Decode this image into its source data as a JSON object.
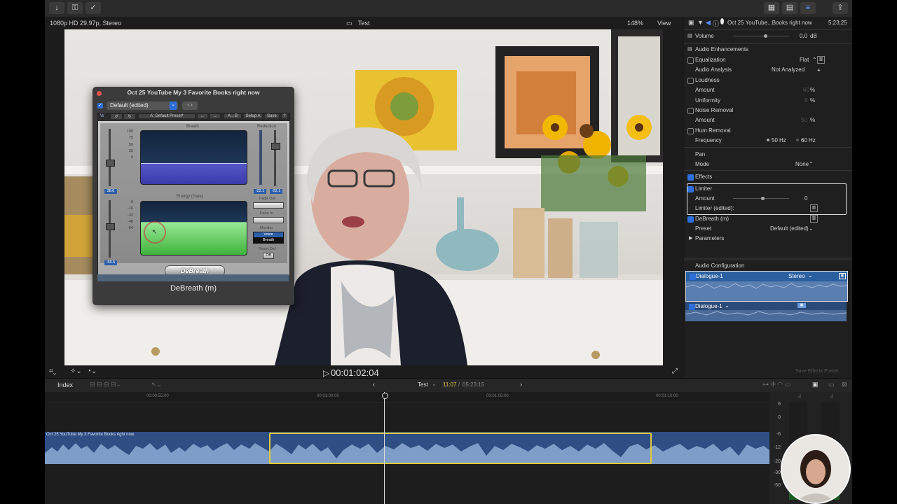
{
  "viewer": {
    "format": "1080p HD 29.97p, Stereo",
    "project_name": "Test",
    "zoom": "148%",
    "view_menu": "View",
    "timecode": "00:01:02:04"
  },
  "plugin": {
    "window_title": "Oct 25 YouTube My 3 Favorite Books right now",
    "preset": "Default (edited)",
    "preset_display": "A: Default Preset*",
    "toolbar_buttons": [
      "A→B",
      "Setup A",
      "Save"
    ],
    "breath_label": "Breath",
    "reduction_label": "Reduction",
    "energy_label": "Energy (Gate)",
    "scale_top": [
      "100",
      "75",
      "50",
      "25",
      "0"
    ],
    "scale_bottom": [
      "0",
      "-16",
      "-32",
      "-48",
      "-64"
    ],
    "fader_value_top": "38.0",
    "fader_value_bottom": "-50.5",
    "reduction_values": [
      "-22.1",
      "-22.1"
    ],
    "fade_out_label": "Fade Out",
    "fade_in_label": "Fade In",
    "monitor_label": "Monitor",
    "monitor_options": [
      "Voice",
      "Breath"
    ],
    "reset_label": "Reset Def",
    "off_label": "Off",
    "brand": "DeBreath",
    "footer_title": "DeBreath (m)"
  },
  "inspector": {
    "header_title": "Oct 25 YouTube...Books right now",
    "header_duration": "5:23;25",
    "volume_label": "Volume",
    "volume_value": "0.0",
    "volume_unit": "dB",
    "audio_enhancements": "Audio Enhancements",
    "equalization": "Equalization",
    "equalization_value": "Flat",
    "audio_analysis": "Audio Analysis",
    "audio_analysis_value": "Not Analyzed",
    "loudness": "Loudness",
    "amount": "Amount",
    "loudness_amount": "60",
    "uniformity": "Uniformity",
    "uniformity_value": "8",
    "percent": "%",
    "noise_removal": "Noise Removal",
    "noise_amount": "50",
    "hum_removal": "Hum Removal",
    "frequency": "Frequency",
    "freq_50": "50",
    "freq_60": "60",
    "hz": "Hz",
    "pan": "Pan",
    "mode": "Mode",
    "mode_value": "None",
    "effects": "Effects",
    "limiter": "Limiter",
    "limiter_amount": "0",
    "limiter_edited": "Limiter (edited):",
    "debreath": "DeBreath (m)",
    "preset": "Preset",
    "preset_value": "Default (edited)",
    "parameters": "Parameters",
    "audio_configuration": "Audio Configuration",
    "dialogue_1": "Dialogue-1",
    "stereo": "Stereo",
    "dialogue_2": "Dialogue-1",
    "save_effects_preset": "Save Effects Preset"
  },
  "timeline": {
    "index_label": "Index",
    "project": "Test",
    "position": "11:07",
    "duration": "05:23:15",
    "ruler": [
      "00:00:55:00",
      "00:01:00:00",
      "00:01:05:00",
      "00:01:10:00"
    ],
    "clip_title": "Oct 25 YouTube My 3 Favorite Books right now"
  },
  "meters": {
    "scale": [
      "6",
      "0",
      "-6",
      "-12",
      "-20",
      "-30",
      "-50"
    ],
    "peaks": [
      "-2",
      "-2"
    ]
  }
}
